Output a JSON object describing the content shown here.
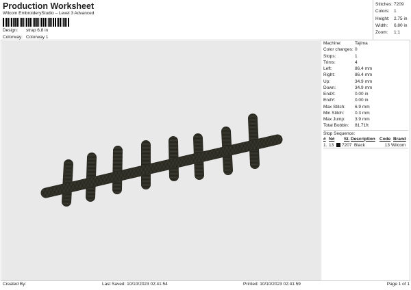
{
  "header": {
    "title": "Production Worksheet",
    "subtitle": "Wilcom EmbroideryStudio – Level 3 Advanced",
    "design_label": "Design:",
    "design_value": "strap 6,8 in",
    "colorway_label": "Colorway:",
    "colorway_value": "Colorway 1"
  },
  "summary": [
    {
      "k": "Stitches:",
      "v": "7209"
    },
    {
      "k": "Colors:",
      "v": "1"
    },
    {
      "k": "Height:",
      "v": "2.75 in"
    },
    {
      "k": "Width:",
      "v": "6.80 in"
    },
    {
      "k": "Zoom:",
      "v": "1:1"
    }
  ],
  "details": [
    {
      "k": "Machine:",
      "v": "Tajima"
    },
    {
      "k": "Color changes:",
      "v": "0"
    },
    {
      "k": "Stops:",
      "v": "1"
    },
    {
      "k": "Trims:",
      "v": "4"
    },
    {
      "k": "Left:",
      "v": "86.4 mm"
    },
    {
      "k": "Right:",
      "v": "86.4 mm"
    },
    {
      "k": "Up:",
      "v": "34.9 mm"
    },
    {
      "k": "Down:",
      "v": "34.9 mm"
    },
    {
      "k": "EndX:",
      "v": "0.00 in"
    },
    {
      "k": "EndY:",
      "v": "0.00 in"
    },
    {
      "k": "Max Stitch:",
      "v": "6.9 mm"
    },
    {
      "k": "Min Stitch:",
      "v": "0.3 mm"
    },
    {
      "k": "Max Jump:",
      "v": "3.9 mm"
    },
    {
      "k": "Total Bobbin:",
      "v": "81.71ft"
    }
  ],
  "stop_sequence": {
    "label": "Stop Sequence:",
    "headers": [
      "#",
      "N#",
      "St.",
      "Description",
      "Code",
      "Brand"
    ],
    "rows": [
      {
        "num": "1.",
        "n": "13",
        "color": "#111111",
        "st": "7207",
        "desc": "Black",
        "code": "13",
        "brand": "Wilcom"
      }
    ]
  },
  "footer": {
    "created": "Created By:",
    "saved": "Last Saved: 10/10/2023 02:41:54",
    "printed": "Printed: 10/10/2023 02:41:59",
    "page": "Page 1 of 1"
  },
  "colors": {
    "thread": "#3b3a30",
    "background": "#e9e9e9"
  }
}
